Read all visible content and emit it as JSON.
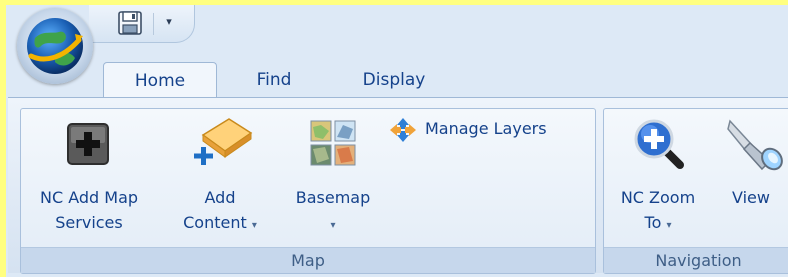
{
  "quick_access": {
    "save_icon": "floppy-disk-icon",
    "dropdown_glyph": "▾"
  },
  "app_button": {
    "icon": "globe-arrow-icon"
  },
  "tabs": [
    {
      "label": "Home",
      "active": true
    },
    {
      "label": "Find",
      "active": false
    },
    {
      "label": "Display",
      "active": false
    }
  ],
  "groups": {
    "map": {
      "label": "Map",
      "buttons": {
        "nc_add_map_services": {
          "line1": "NC Add Map",
          "line2": "Services",
          "icon": "add-plus-icon"
        },
        "add_content": {
          "line1": "Add",
          "line2": "Content",
          "arrow": "▾",
          "icon": "add-content-icon"
        },
        "basemap": {
          "line1": "Basemap",
          "arrow": "▾",
          "icon": "basemap-grid-icon"
        },
        "manage_layers": {
          "label": "Manage Layers",
          "icon": "manage-layers-icon"
        }
      }
    },
    "navigation": {
      "label": "Navigation",
      "buttons": {
        "nc_zoom_to": {
          "line1": "NC Zoom",
          "line2": "To",
          "arrow": "▾",
          "icon": "zoom-in-magnifier-icon"
        },
        "view": {
          "line1": "View",
          "icon": "binoculars-icon"
        }
      }
    }
  },
  "colors": {
    "accent_text": "#15428b",
    "ribbon_bg": "#dde9f6",
    "highlight_background": "#ffff80"
  }
}
